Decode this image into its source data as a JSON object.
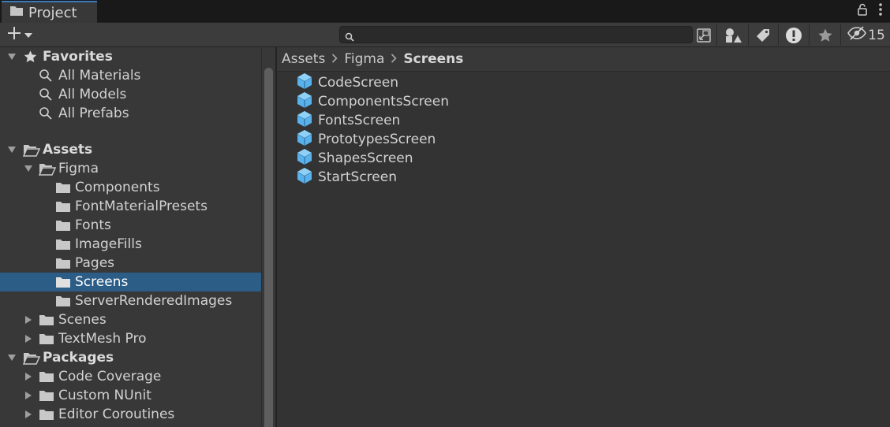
{
  "window": {
    "tab_title": "Project"
  },
  "toolbar": {
    "search_placeholder": "",
    "hidden_count": "15"
  },
  "colors": {
    "accent": "#2c5d87",
    "tab_accent": "#3a79bb",
    "prefab": "#5ab2ec"
  },
  "tree": {
    "favorites": {
      "label": "Favorites",
      "items": [
        "All Materials",
        "All Models",
        "All Prefabs"
      ]
    },
    "assets": {
      "label": "Assets",
      "figma": {
        "label": "Figma",
        "children": [
          "Components",
          "FontMaterialPresets",
          "Fonts",
          "ImageFills",
          "Pages",
          "Screens",
          "ServerRenderedImages"
        ],
        "selected": "Screens"
      },
      "others": [
        "Scenes",
        "TextMesh Pro"
      ]
    },
    "packages": {
      "label": "Packages",
      "items": [
        "Code Coverage",
        "Custom NUnit",
        "Editor Coroutines"
      ]
    }
  },
  "breadcrumb": {
    "parts": [
      "Assets",
      "Figma"
    ],
    "current": "Screens"
  },
  "files": [
    "CodeScreen",
    "ComponentsScreen",
    "FontsScreen",
    "PrototypesScreen",
    "ShapesScreen",
    "StartScreen"
  ]
}
